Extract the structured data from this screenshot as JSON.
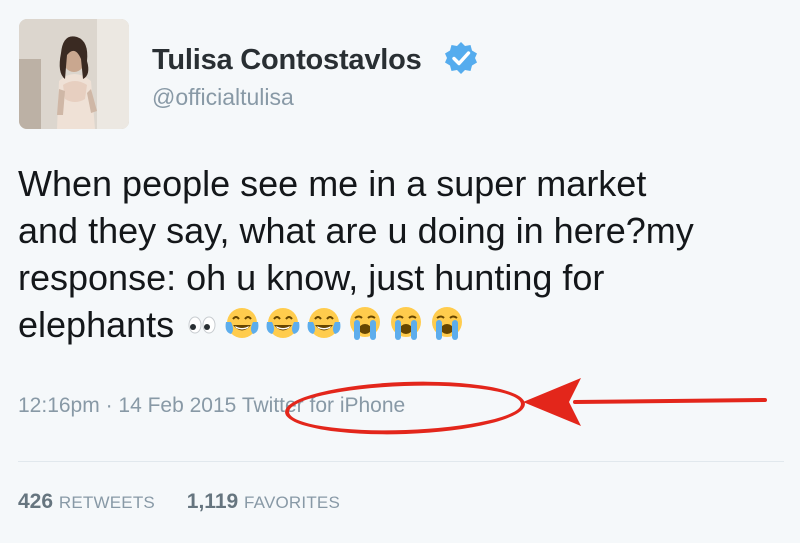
{
  "author": {
    "name": "Tulisa Contostavlos",
    "handle": "@officialtulisa",
    "verified": true
  },
  "tweet": {
    "lines": [
      "When people see me in a super market",
      "and they say, what are u doing in here?my",
      "response: oh u know, just hunting for",
      "elephants"
    ],
    "emojis": [
      "eyes-emoji",
      "face-with-tears-of-joy-emoji",
      "face-with-tears-of-joy-emoji",
      "face-with-tears-of-joy-emoji",
      "loudly-crying-face-emoji",
      "loudly-crying-face-emoji",
      "loudly-crying-face-emoji"
    ]
  },
  "meta": {
    "time": "12:16pm",
    "separator": " · ",
    "date": "14 Feb 2015",
    "source": "Twitter for iPhone"
  },
  "stats": {
    "retweets_count": "426",
    "retweets_label": "RETWEETS",
    "favorites_count": "1,119",
    "favorites_label": "FAVORITES"
  },
  "colors": {
    "verified_badge": "#55acee",
    "annotation": "#e3261b",
    "secondary_text": "#8899a6"
  }
}
